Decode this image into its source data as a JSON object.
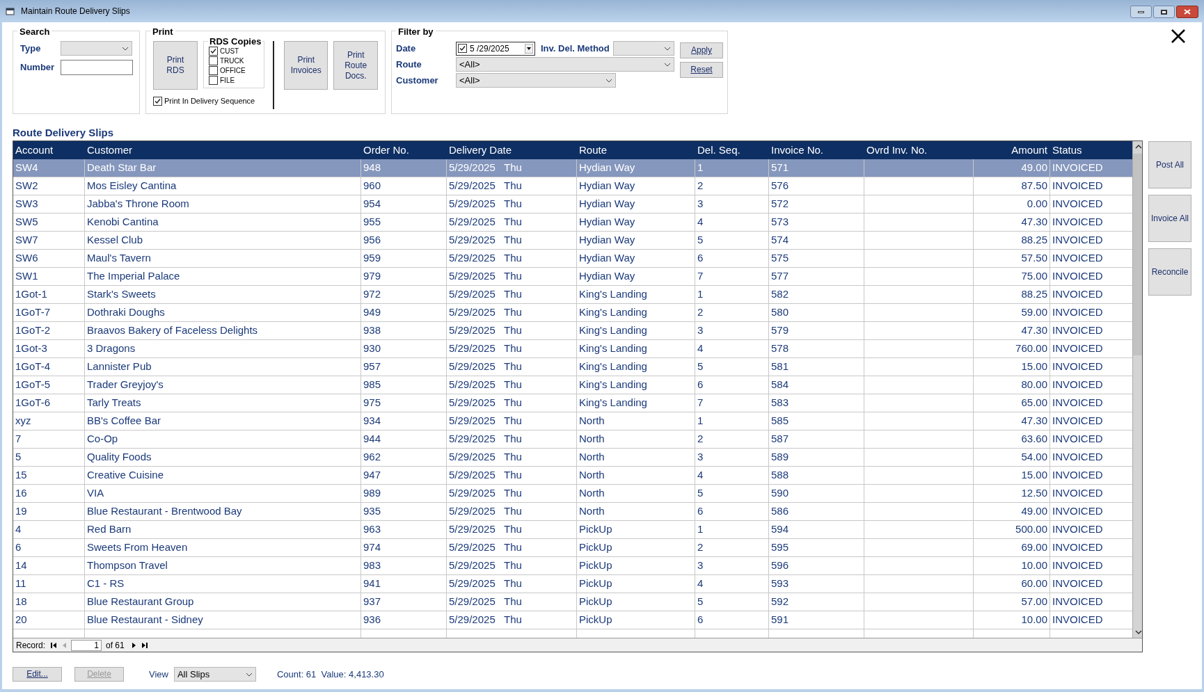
{
  "window": {
    "title": "Maintain Route Delivery Slips"
  },
  "search": {
    "title": "Search",
    "type_label": "Type",
    "number_label": "Number"
  },
  "print": {
    "title": "Print",
    "print_rds": "Print RDS",
    "copies_title": "RDS Copies",
    "copies": [
      {
        "label": "CUST",
        "checked": true
      },
      {
        "label": "TRUCK",
        "checked": false
      },
      {
        "label": "OFFICE",
        "checked": false
      },
      {
        "label": "FILE",
        "checked": false
      }
    ],
    "sequence": {
      "label": "Print In Delivery Sequence",
      "checked": true
    },
    "print_invoices": "Print Invoices",
    "print_route_docs": "Print Route Docs."
  },
  "filter": {
    "title": "Filter by",
    "date_label": "Date",
    "date_checked": true,
    "date": "5 /29/2025",
    "method_label": "Inv. Del. Method",
    "route_label": "Route",
    "route": "<All>",
    "customer_label": "Customer",
    "customer": "<All>",
    "apply": "Apply",
    "reset": "Reset"
  },
  "heading": "Route Delivery Slips",
  "table": {
    "columns": [
      "Account",
      "Customer",
      "Order No.",
      "Delivery Date",
      "Route",
      "Del. Seq.",
      "Invoice No.",
      "Ovrd Inv. No.",
      "Amount",
      "Status"
    ],
    "rows": [
      {
        "selected": true,
        "cells": [
          "SW4",
          "Death Star Bar",
          "948",
          "5/29/2025   Thu",
          "Hydian Way",
          "1",
          "571",
          "",
          "49.00",
          "INVOICED"
        ]
      },
      {
        "selected": false,
        "cells": [
          "SW2",
          "Mos Eisley Cantina",
          "960",
          "5/29/2025   Thu",
          "Hydian Way",
          "2",
          "576",
          "",
          "87.50",
          "INVOICED"
        ]
      },
      {
        "selected": false,
        "cells": [
          "SW3",
          "Jabba's Throne Room",
          "954",
          "5/29/2025   Thu",
          "Hydian Way",
          "3",
          "572",
          "",
          "0.00",
          "INVOICED"
        ]
      },
      {
        "selected": false,
        "cells": [
          "SW5",
          "Kenobi Cantina",
          "955",
          "5/29/2025   Thu",
          "Hydian Way",
          "4",
          "573",
          "",
          "47.30",
          "INVOICED"
        ]
      },
      {
        "selected": false,
        "cells": [
          "SW7",
          "Kessel Club",
          "956",
          "5/29/2025   Thu",
          "Hydian Way",
          "5",
          "574",
          "",
          "88.25",
          "INVOICED"
        ]
      },
      {
        "selected": false,
        "cells": [
          "SW6",
          "Maul's Tavern",
          "959",
          "5/29/2025   Thu",
          "Hydian Way",
          "6",
          "575",
          "",
          "57.50",
          "INVOICED"
        ]
      },
      {
        "selected": false,
        "cells": [
          "SW1",
          "The Imperial Palace",
          "979",
          "5/29/2025   Thu",
          "Hydian Way",
          "7",
          "577",
          "",
          "75.00",
          "INVOICED"
        ]
      },
      {
        "selected": false,
        "cells": [
          "1Got-1",
          "Stark's Sweets",
          "972",
          "5/29/2025   Thu",
          "King's Landing",
          "1",
          "582",
          "",
          "88.25",
          "INVOICED"
        ]
      },
      {
        "selected": false,
        "cells": [
          "1GoT-7",
          "Dothraki Doughs",
          "949",
          "5/29/2025   Thu",
          "King's Landing",
          "2",
          "580",
          "",
          "59.00",
          "INVOICED"
        ]
      },
      {
        "selected": false,
        "cells": [
          "1GoT-2",
          "Braavos Bakery of Faceless Delights",
          "938",
          "5/29/2025   Thu",
          "King's Landing",
          "3",
          "579",
          "",
          "47.30",
          "INVOICED"
        ]
      },
      {
        "selected": false,
        "cells": [
          "1Got-3",
          "3 Dragons",
          "930",
          "5/29/2025   Thu",
          "King's Landing",
          "4",
          "578",
          "",
          "760.00",
          "INVOICED"
        ]
      },
      {
        "selected": false,
        "cells": [
          "1GoT-4",
          "Lannister Pub",
          "957",
          "5/29/2025   Thu",
          "King's Landing",
          "5",
          "581",
          "",
          "15.00",
          "INVOICED"
        ]
      },
      {
        "selected": false,
        "cells": [
          "1GoT-5",
          "Trader Greyjoy's",
          "985",
          "5/29/2025   Thu",
          "King's Landing",
          "6",
          "584",
          "",
          "80.00",
          "INVOICED"
        ]
      },
      {
        "selected": false,
        "cells": [
          "1GoT-6",
          "Tarly Treats",
          "975",
          "5/29/2025   Thu",
          "King's Landing",
          "7",
          "583",
          "",
          "65.00",
          "INVOICED"
        ]
      },
      {
        "selected": false,
        "cells": [
          "xyz",
          "BB's Coffee Bar",
          "934",
          "5/29/2025   Thu",
          "North",
          "1",
          "585",
          "",
          "47.30",
          "INVOICED"
        ]
      },
      {
        "selected": false,
        "cells": [
          "7",
          "Co-Op",
          "944",
          "5/29/2025   Thu",
          "North",
          "2",
          "587",
          "",
          "63.60",
          "INVOICED"
        ]
      },
      {
        "selected": false,
        "cells": [
          "5",
          "Quality Foods",
          "962",
          "5/29/2025   Thu",
          "North",
          "3",
          "589",
          "",
          "54.00",
          "INVOICED"
        ]
      },
      {
        "selected": false,
        "cells": [
          "15",
          "Creative Cuisine",
          "947",
          "5/29/2025   Thu",
          "North",
          "4",
          "588",
          "",
          "15.00",
          "INVOICED"
        ]
      },
      {
        "selected": false,
        "cells": [
          "16",
          "VIA",
          "989",
          "5/29/2025   Thu",
          "North",
          "5",
          "590",
          "",
          "12.50",
          "INVOICED"
        ]
      },
      {
        "selected": false,
        "cells": [
          "19",
          "Blue Restaurant - Brentwood Bay",
          "935",
          "5/29/2025   Thu",
          "North",
          "6",
          "586",
          "",
          "49.00",
          "INVOICED"
        ]
      },
      {
        "selected": false,
        "cells": [
          "4",
          "Red Barn",
          "963",
          "5/29/2025   Thu",
          "PickUp",
          "1",
          "594",
          "",
          "500.00",
          "INVOICED"
        ]
      },
      {
        "selected": false,
        "cells": [
          "6",
          "Sweets From Heaven",
          "974",
          "5/29/2025   Thu",
          "PickUp",
          "2",
          "595",
          "",
          "69.00",
          "INVOICED"
        ]
      },
      {
        "selected": false,
        "cells": [
          "14",
          "Thompson Travel",
          "983",
          "5/29/2025   Thu",
          "PickUp",
          "3",
          "596",
          "",
          "10.00",
          "INVOICED"
        ]
      },
      {
        "selected": false,
        "cells": [
          "11",
          "C1 - RS",
          "941",
          "5/29/2025   Thu",
          "PickUp",
          "4",
          "593",
          "",
          "60.00",
          "INVOICED"
        ]
      },
      {
        "selected": false,
        "cells": [
          "18",
          "Blue Restaurant Group",
          "937",
          "5/29/2025   Thu",
          "PickUp",
          "5",
          "592",
          "",
          "57.00",
          "INVOICED"
        ]
      },
      {
        "selected": false,
        "cells": [
          "20",
          "Blue Restaurant - Sidney",
          "936",
          "5/29/2025   Thu",
          "PickUp",
          "6",
          "591",
          "",
          "10.00",
          "INVOICED"
        ]
      }
    ]
  },
  "record_nav": {
    "label": "Record:",
    "current": "1",
    "of": "of 61"
  },
  "side_buttons": [
    "Post All",
    "Invoice All",
    "Reconcile"
  ],
  "footer": {
    "edit": "Edit...",
    "delete": "Delete",
    "delete_disabled": true,
    "view_label": "View",
    "view": "All Slips",
    "summary": "Count: 61  Value: 4,413.30"
  }
}
